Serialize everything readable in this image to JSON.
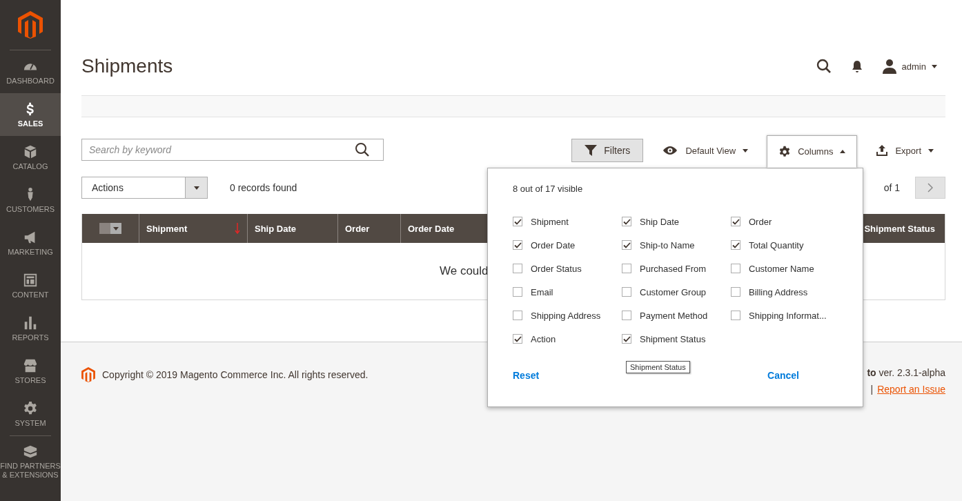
{
  "sidebar": {
    "items": [
      {
        "label": "DASHBOARD",
        "selected": false
      },
      {
        "label": "SALES",
        "selected": true
      },
      {
        "label": "CATALOG",
        "selected": false
      },
      {
        "label": "CUSTOMERS",
        "selected": false
      },
      {
        "label": "MARKETING",
        "selected": false
      },
      {
        "label": "CONTENT",
        "selected": false
      },
      {
        "label": "REPORTS",
        "selected": false
      },
      {
        "label": "STORES",
        "selected": false
      },
      {
        "label": "SYSTEM",
        "selected": false
      },
      {
        "label": "FIND PARTNERS & EXTENSIONS",
        "selected": false
      }
    ]
  },
  "header": {
    "title": "Shipments",
    "user": "admin"
  },
  "toolbar": {
    "search": {
      "placeholder": "Search by keyword"
    },
    "buttons": [
      {
        "kind": "filters",
        "label": "Filters",
        "expanded": false
      },
      {
        "kind": "view",
        "label": "Default View",
        "expanded": false
      },
      {
        "kind": "columns",
        "label": "Columns",
        "expanded": true
      },
      {
        "kind": "export",
        "label": "Export",
        "expanded": false
      }
    ]
  },
  "actions": {
    "label": "Actions",
    "records": "0 records found",
    "pages": "of 1"
  },
  "table": {
    "mass_select": {
      "checked": false
    },
    "columns": [
      {
        "label": "Shipment",
        "sorted": true
      },
      {
        "label": "Ship Date",
        "sorted": false
      },
      {
        "label": "Order",
        "sorted": false
      },
      {
        "label": "Order Date",
        "sorted": false
      },
      {
        "label": "Shipment Status",
        "sorted": false
      }
    ],
    "empty_message": "We could"
  },
  "columns_panel": {
    "summary": "8 out of 17 visible",
    "options": [
      {
        "label": "Shipment",
        "checked": true
      },
      {
        "label": "Ship Date",
        "checked": true
      },
      {
        "label": "Order",
        "checked": true
      },
      {
        "label": "Order Date",
        "checked": true
      },
      {
        "label": "Ship-to Name",
        "checked": true
      },
      {
        "label": "Total Quantity",
        "checked": true
      },
      {
        "label": "Order Status",
        "checked": false
      },
      {
        "label": "Purchased From",
        "checked": false
      },
      {
        "label": "Customer Name",
        "checked": false
      },
      {
        "label": "Email",
        "checked": false
      },
      {
        "label": "Customer Group",
        "checked": false
      },
      {
        "label": "Billing Address",
        "checked": false
      },
      {
        "label": "Shipping Address",
        "checked": false
      },
      {
        "label": "Payment Method",
        "checked": false
      },
      {
        "label": "Shipping Informat...",
        "checked": false
      },
      {
        "label": "Action",
        "checked": true
      },
      {
        "label": "Shipment Status",
        "checked": true
      }
    ],
    "tooltip": "Shipment Status",
    "reset": "Reset",
    "cancel": "Cancel"
  },
  "footer": {
    "copyright": "Copyright © 2019 Magento Commerce Inc. All rights reserved.",
    "version": "**to** ver. 2.3.1-alpha",
    "separator": "|",
    "link": "Report an Issue"
  }
}
